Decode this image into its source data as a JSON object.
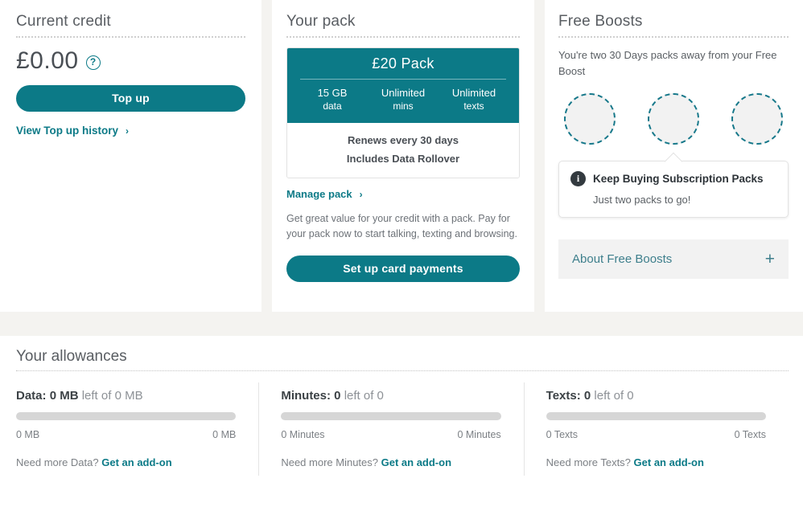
{
  "credit": {
    "title": "Current credit",
    "amount": "£0.00",
    "help_icon": "question-mark-icon",
    "topup_button": "Top up",
    "history_link": "View Top up history",
    "chevron": "›"
  },
  "pack": {
    "title": "Your pack",
    "card": {
      "name": "£20 Pack",
      "features": [
        {
          "value": "15 GB",
          "unit": "data"
        },
        {
          "value": "Unlimited",
          "unit": "mins"
        },
        {
          "value": "Unlimited",
          "unit": "texts"
        }
      ],
      "footer": [
        "Renews every 30 days",
        "Includes Data Rollover"
      ]
    },
    "manage_link": "Manage pack",
    "chevron": "›",
    "description": "Get great value for your credit with a pack. Pay for your pack now to start talking, texting and browsing.",
    "cta_button": "Set up card payments"
  },
  "boosts": {
    "title": "Free Boosts",
    "intro": "You're two 30 Days packs away from your Free Boost",
    "circle_count": 3,
    "tooltip": {
      "icon": "info-icon",
      "icon_glyph": "i",
      "title": "Keep Buying Subscription Packs",
      "body": "Just two packs to go!"
    },
    "accordion": {
      "label": "About Free Boosts",
      "toggle": "+"
    }
  },
  "allowances": {
    "title": "Your allowances",
    "items": [
      {
        "label": "Data:",
        "remaining": "0 MB",
        "middle": "left of",
        "total": "0 MB",
        "bar_percent": 0,
        "min_label": "0 MB",
        "max_label": "0 MB",
        "need_text": "Need more Data?",
        "addon_link": "Get an add-on"
      },
      {
        "label": "Minutes:",
        "remaining": "0",
        "middle": "left of",
        "total": "0",
        "bar_percent": 0,
        "min_label": "0 Minutes",
        "max_label": "0 Minutes",
        "need_text": "Need more Minutes?",
        "addon_link": "Get an add-on"
      },
      {
        "label": "Texts:",
        "remaining": "0",
        "middle": "left of",
        "total": "0",
        "bar_percent": 0,
        "min_label": "0 Texts",
        "max_label": "0 Texts",
        "need_text": "Need more Texts?",
        "addon_link": "Get an add-on"
      }
    ]
  },
  "colors": {
    "brand_teal": "#0c7a87",
    "page_bg": "#f4f3f0",
    "panel_bg": "#ffffff",
    "bar_track": "#d6d6d6",
    "heading_text": "#595d62"
  }
}
